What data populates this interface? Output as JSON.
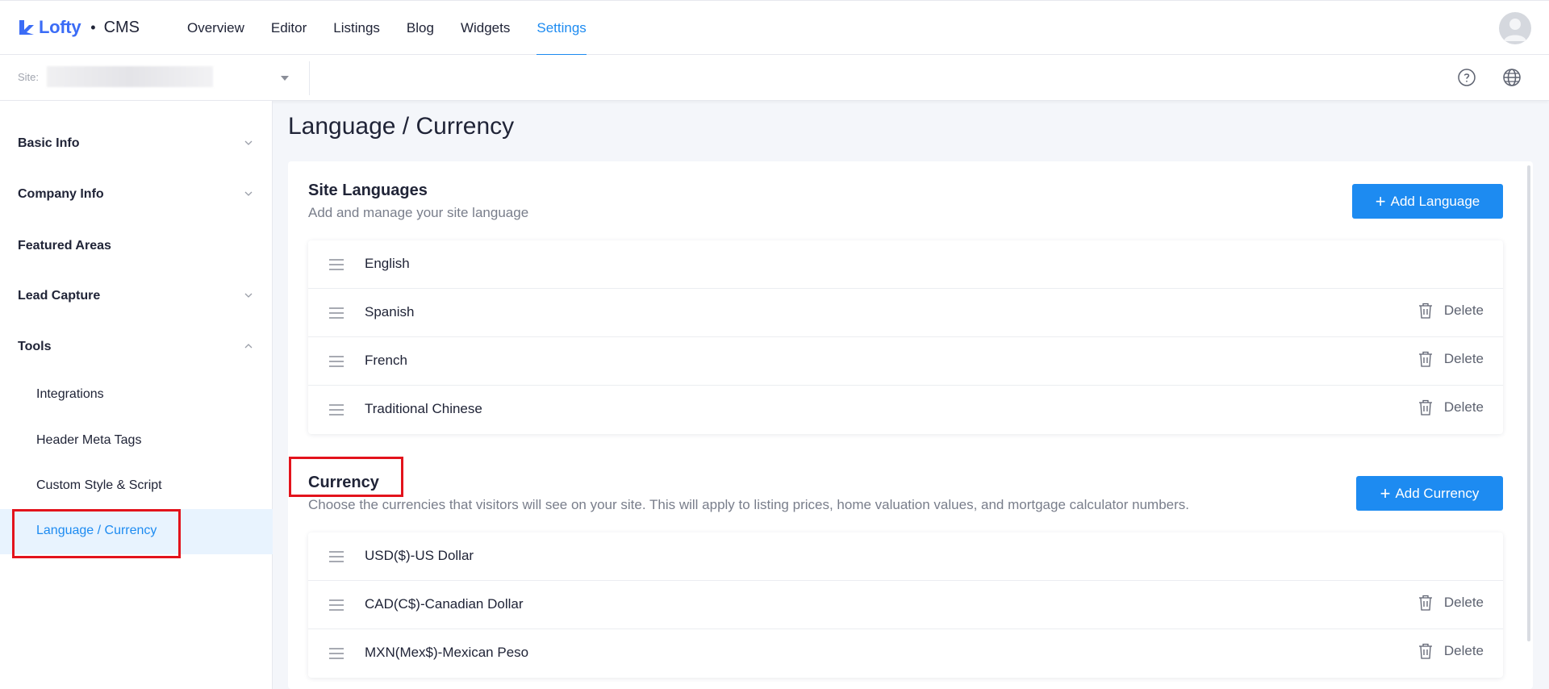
{
  "brand": {
    "name": "Lofty",
    "separator": "•",
    "product": "CMS",
    "color": "#3b6cf6"
  },
  "nav": {
    "items": [
      {
        "label": "Overview"
      },
      {
        "label": "Editor"
      },
      {
        "label": "Listings"
      },
      {
        "label": "Blog"
      },
      {
        "label": "Widgets"
      },
      {
        "label": "Settings",
        "active": true
      }
    ]
  },
  "site_selector": {
    "label": "Site:",
    "value": ""
  },
  "sidebar": {
    "items": [
      {
        "label": "Basic Info",
        "chevron": "down"
      },
      {
        "label": "Company Info",
        "chevron": "down"
      },
      {
        "label": "Featured Areas"
      },
      {
        "label": "Lead Capture",
        "chevron": "down"
      },
      {
        "label": "Tools",
        "chevron": "up"
      }
    ],
    "sub_items": [
      {
        "label": "Integrations"
      },
      {
        "label": "Header Meta Tags"
      },
      {
        "label": "Custom Style & Script"
      },
      {
        "label": "Language / Currency",
        "active": true
      }
    ]
  },
  "page": {
    "title": "Language / Currency"
  },
  "languages": {
    "title": "Site Languages",
    "description": "Add and manage your site language",
    "add_button": "Add Language",
    "items": [
      {
        "label": "English",
        "deletable": false
      },
      {
        "label": "Spanish",
        "deletable": true
      },
      {
        "label": "French",
        "deletable": true
      },
      {
        "label": "Traditional Chinese",
        "deletable": true
      }
    ]
  },
  "currency": {
    "title": "Currency",
    "description": "Choose the currencies that visitors will see on your site. This will apply to listing prices, home valuation values, and mortgage calculator numbers.",
    "add_button": "Add Currency",
    "items": [
      {
        "label": "USD($)-US Dollar",
        "deletable": false
      },
      {
        "label": "CAD(C$)-Canadian Dollar",
        "deletable": true
      },
      {
        "label": "MXN(Mex$)-Mexican Peso",
        "deletable": true
      }
    ]
  },
  "delete_label": "Delete",
  "colors": {
    "accent": "#1d8bf1",
    "highlight": "#e3131c"
  }
}
